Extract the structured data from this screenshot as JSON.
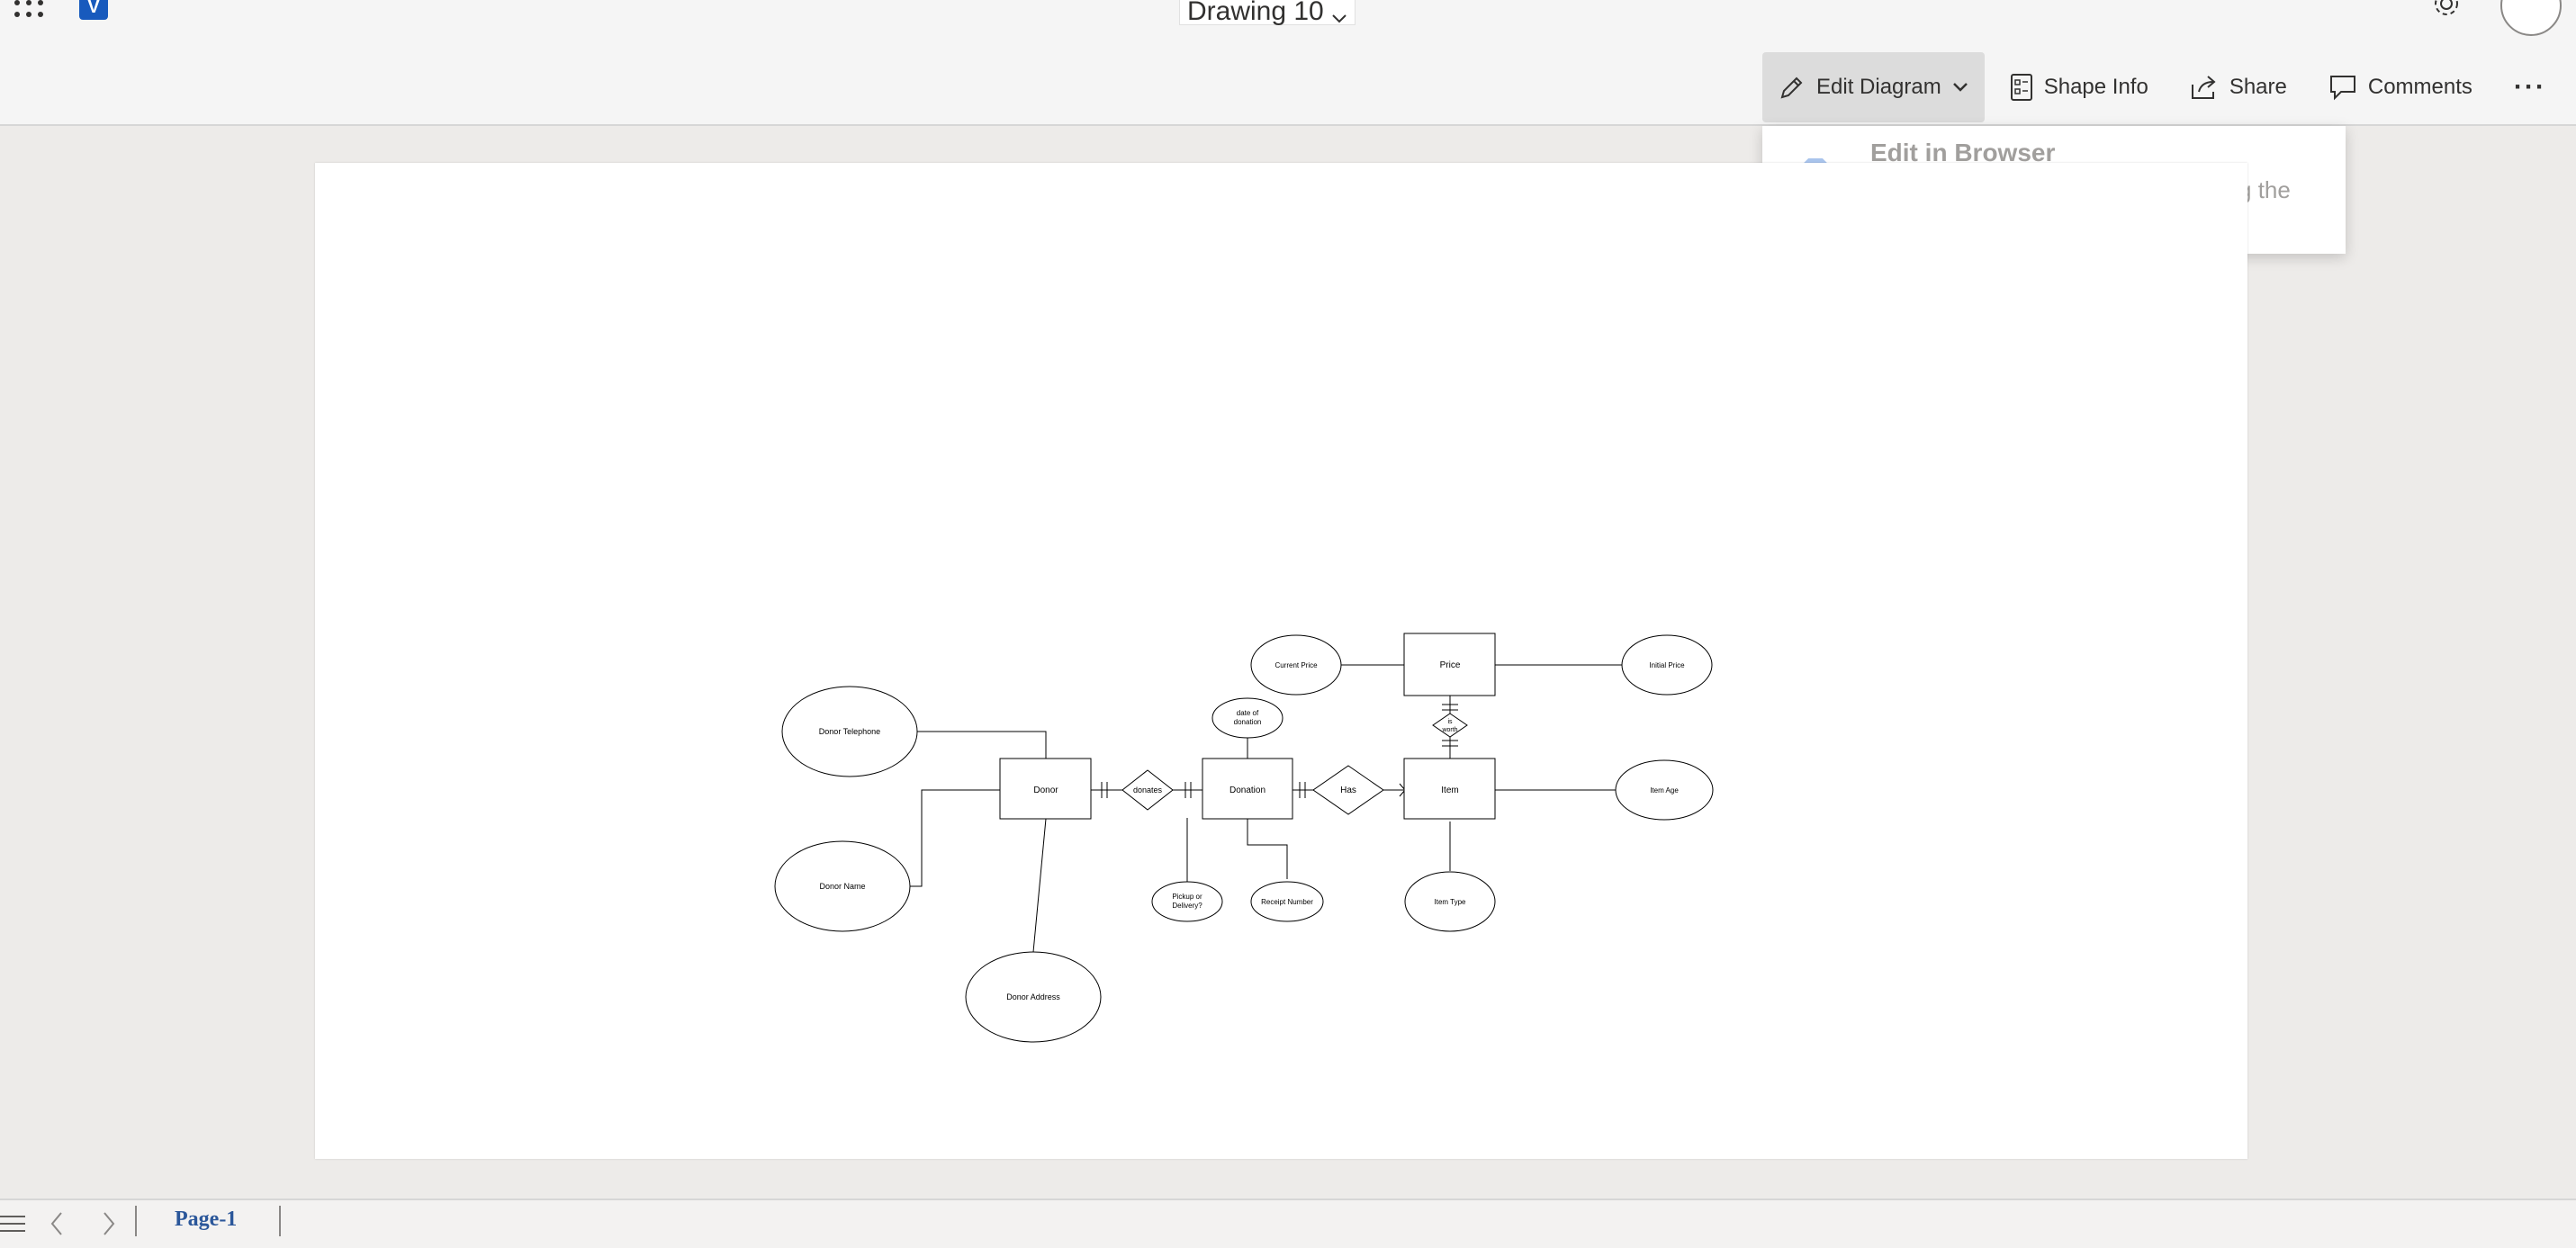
{
  "app": {
    "document_title": "Drawing 10",
    "logo_letter": "V"
  },
  "toolbar": {
    "edit_diagram": "Edit Diagram",
    "shape_info": "Shape Info",
    "share": "Share",
    "comments": "Comments",
    "more": "···"
  },
  "dropdown": {
    "title": "Edit in Browser",
    "description": "Make quick changes right here using the web version of Visio.",
    "icon_letter": "V"
  },
  "diagram": {
    "entities": {
      "donor": "Donor",
      "donation": "Donation",
      "item": "Item",
      "price": "Price"
    },
    "relationships": {
      "donates": "donates",
      "has": "Has",
      "is_worth": [
        "is",
        "worth"
      ]
    },
    "attributes": {
      "donor_telephone": "Donor Telephone",
      "donor_name": "Donor Name",
      "donor_address": "Donor Address",
      "date_of_donation": [
        "date of",
        "donation"
      ],
      "pickup_or_delivery": [
        "Pickup or",
        "Delivery?"
      ],
      "receipt_number": "Receipt Number",
      "current_price": "Current Price",
      "initial_price": "Initial Price",
      "item_age": "Item Age",
      "item_type": "Item Type"
    }
  },
  "pages": {
    "current": "Page-1"
  }
}
